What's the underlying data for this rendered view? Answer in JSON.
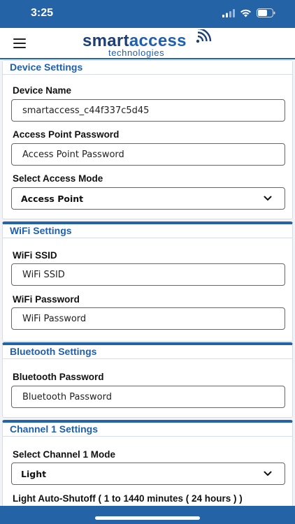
{
  "status_bar": {
    "time": "3:25"
  },
  "header": {
    "logo_main_a": "smart",
    "logo_main_b": "access",
    "logo_sub": "technologies"
  },
  "device_settings": {
    "title": "Device Settings",
    "device_name_label": "Device Name",
    "device_name_value": "smartaccess_c44f337c5d45",
    "ap_password_label": "Access Point Password",
    "ap_password_placeholder": "Access Point Password",
    "access_mode_label": "Select Access Mode",
    "access_mode_value": "Access Point"
  },
  "wifi_settings": {
    "title": "WiFi Settings",
    "ssid_label": "WiFi SSID",
    "ssid_placeholder": "WiFi SSID",
    "password_label": "WiFi Password",
    "password_placeholder": "WiFi Password"
  },
  "bluetooth_settings": {
    "title": "Bluetooth Settings",
    "password_label": "Bluetooth Password",
    "password_placeholder": "Bluetooth Password"
  },
  "channel1_settings": {
    "title": "Channel 1 Settings",
    "mode_label": "Select Channel 1 Mode",
    "mode_value": "Light",
    "auto_shutoff_label": "Light Auto-Shutoff ( 1 to 1440 minutes ( 24 hours ) )"
  },
  "colors": {
    "accent": "#2563a7",
    "title_text": "#1f5fae"
  }
}
